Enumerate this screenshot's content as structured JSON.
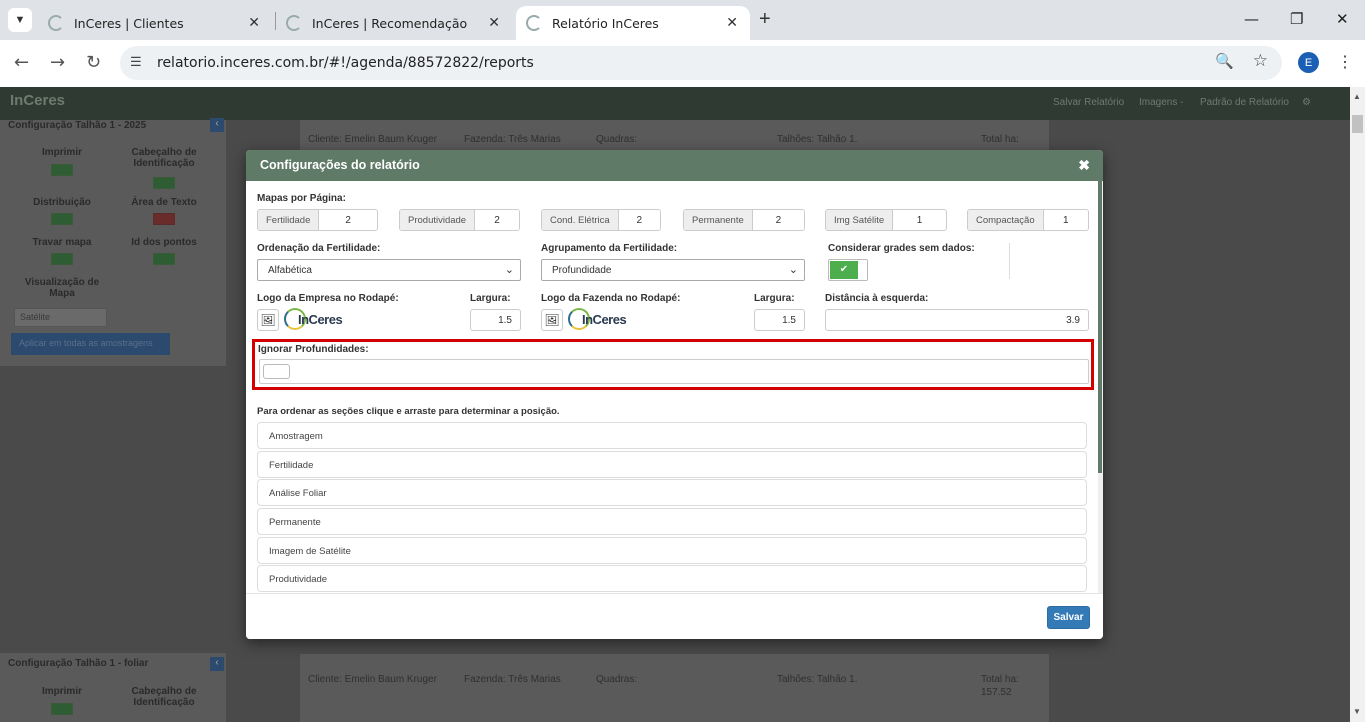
{
  "browser": {
    "tabs": [
      {
        "title": "InCeres | Clientes"
      },
      {
        "title": "InCeres | Recomendação"
      },
      {
        "title": "Relatório InCeres"
      }
    ],
    "url": "relatorio.inceres.com.br/#!/agenda/88572822/reports",
    "profile_initial": "E"
  },
  "app_header": {
    "logo": "InCeres",
    "links": [
      "Salvar Relatório",
      "Imagens -",
      "Padrão de Relatório"
    ]
  },
  "sidebar_top": {
    "title": "Configuração Talhão 1 - 2025",
    "options": [
      {
        "label": "Imprimir",
        "on": true
      },
      {
        "label": "Cabeçalho de Identificação",
        "on": true
      },
      {
        "label": "Distribuição",
        "on": true
      },
      {
        "label": "Área de Texto",
        "on": false
      },
      {
        "label": "Travar mapa",
        "on": true
      },
      {
        "label": "Id dos pontos",
        "on": true
      }
    ],
    "map_view_label": "Visualização de Mapa",
    "map_view_value": "Satélite",
    "apply_label": "Aplicar em todas as amostragens"
  },
  "sidebar_bottom": {
    "title": "Configuração Talhão 1 - foliar",
    "options": [
      {
        "label": "Imprimir",
        "on": true
      },
      {
        "label": "Cabeçalho de Identificação",
        "on": true
      }
    ]
  },
  "report_top": {
    "client": "Cliente: Emelin Baum Kruger",
    "farm": "Fazenda: Três Marias",
    "blocks": "Quadras:",
    "plots": "Talhões: Talhão 1.",
    "total_ha": "Total ha:"
  },
  "report_bottom": {
    "client": "Cliente: Emelin Baum Kruger",
    "farm": "Fazenda: Três Marias",
    "blocks": "Quadras:",
    "plots": "Talhões: Talhão 1.",
    "total_ha": "Total ha:",
    "total_ha_value": "157.52"
  },
  "modal": {
    "title": "Configurações do relatório",
    "maps_per_page_label": "Mapas por Página:",
    "maps_per_page": [
      {
        "label": "Fertilidade",
        "value": "2"
      },
      {
        "label": "Produtividade",
        "value": "2"
      },
      {
        "label": "Cond. Elétrica",
        "value": "2"
      },
      {
        "label": "Permanente",
        "value": "2"
      },
      {
        "label": "Img Satélite",
        "value": "1"
      },
      {
        "label": "Compactação",
        "value": "1"
      }
    ],
    "fertility_order_label": "Ordenação da Fertilidade:",
    "fertility_order_value": "Alfabética",
    "fertility_group_label": "Agrupamento da Fertilidade:",
    "fertility_group_value": "Profundidade",
    "empty_grids_label": "Considerar grades sem dados:",
    "empty_grids_on": true,
    "company_logo_label": "Logo da Empresa no Rodapé:",
    "company_logo_text": "InCeres",
    "width_label": "Largura:",
    "company_logo_width": "1.5",
    "farm_logo_label": "Logo da Fazenda no Rodapé:",
    "farm_logo_text": "InCeres",
    "farm_logo_width": "1.5",
    "left_distance_label": "Distância à esquerda:",
    "left_distance_value": "3.9",
    "ignore_depths_label": "Ignorar Profundidades:",
    "sections_hint": "Para ordenar as seções clique e arraste para determinar a posição.",
    "sections": [
      "Amostragem",
      "Fertilidade",
      "Análise Foliar",
      "Permanente",
      "Imagem de Satélite",
      "Produtividade"
    ],
    "save_label": "Salvar"
  },
  "colors": {
    "modal_header": "#5f7a67",
    "highlight_border": "#d40000",
    "save_button": "#337ab7",
    "toggle_on": "#4cae4c"
  }
}
